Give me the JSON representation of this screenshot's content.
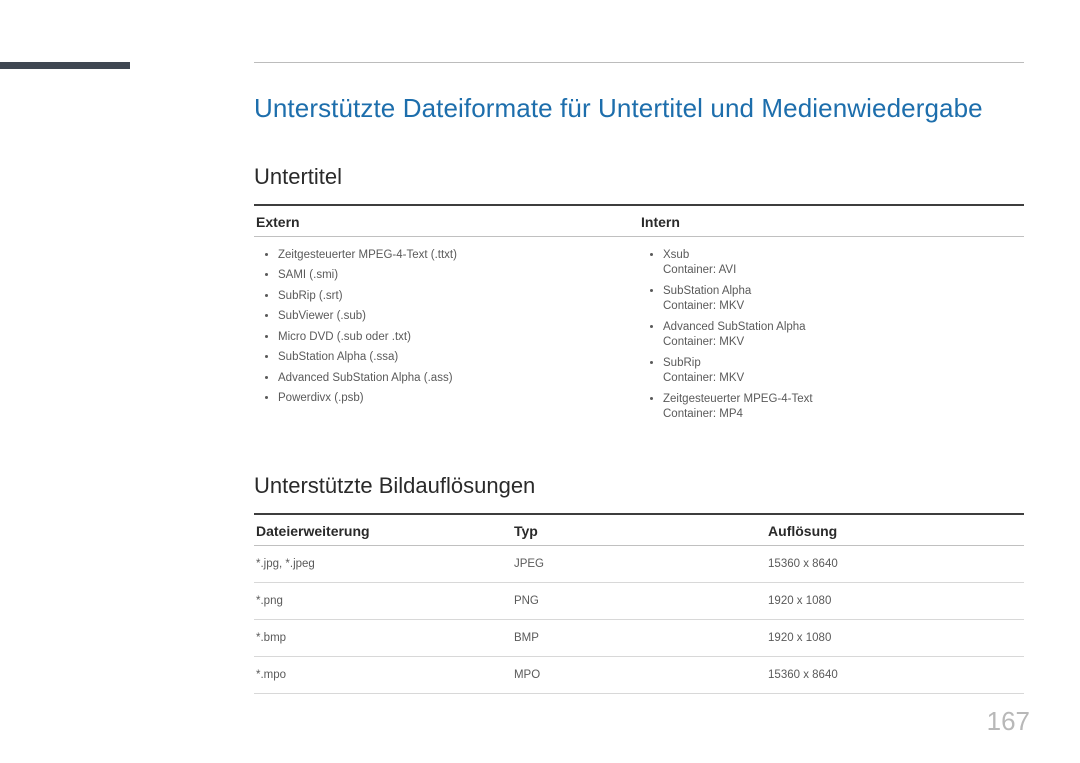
{
  "page": {
    "title": "Unterstützte Dateiformate für Untertitel und Medienwiedergabe",
    "section_subtitle_1": "Untertitel",
    "subtitle_cols": {
      "extern": {
        "label": "Extern",
        "items": [
          {
            "t": "Zeitgesteuerter MPEG-4-Text (.ttxt)"
          },
          {
            "t": "SAMI (.smi)"
          },
          {
            "t": "SubRip (.srt)"
          },
          {
            "t": "SubViewer (.sub)"
          },
          {
            "t": "Micro DVD (.sub oder .txt)"
          },
          {
            "t": "SubStation Alpha (.ssa)"
          },
          {
            "t": "Advanced SubStation Alpha (.ass)"
          },
          {
            "t": "Powerdivx (.psb)"
          }
        ]
      },
      "intern": {
        "label": "Intern",
        "items": [
          {
            "t": "Xsub",
            "sub": "Container: AVI"
          },
          {
            "t": "SubStation Alpha",
            "sub": "Container: MKV"
          },
          {
            "t": "Advanced SubStation Alpha",
            "sub": "Container: MKV"
          },
          {
            "t": "SubRip",
            "sub": "Container: MKV"
          },
          {
            "t": "Zeitgesteuerter MPEG-4-Text",
            "sub": "Container: MP4"
          }
        ]
      }
    },
    "section_subtitle_2": "Unterstützte Bildauflösungen",
    "res_table": {
      "headers": {
        "ext": "Dateierweiterung",
        "type": "Typ",
        "res": "Auflösung"
      },
      "rows": [
        {
          "ext": "*.jpg, *.jpeg",
          "type": "JPEG",
          "res": "15360 x 8640"
        },
        {
          "ext": "*.png",
          "type": "PNG",
          "res": "1920 x 1080"
        },
        {
          "ext": "*.bmp",
          "type": "BMP",
          "res": "1920 x 1080"
        },
        {
          "ext": "*.mpo",
          "type": "MPO",
          "res": "15360 x 8640"
        }
      ]
    },
    "page_number": "167"
  }
}
